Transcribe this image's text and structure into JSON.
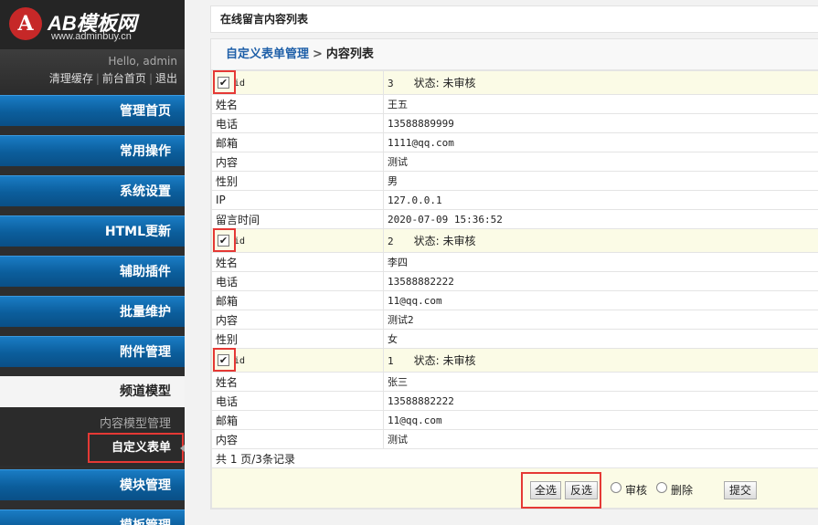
{
  "brand": {
    "logo_letter": "A",
    "title": "AB模板网",
    "subtitle": "www.adminbuy.cn"
  },
  "user": {
    "greeting": "Hello, admin",
    "links": [
      "清理缓存",
      "前台首页",
      "退出"
    ]
  },
  "sidebar": {
    "items_top": [
      "管理首页",
      "常用操作",
      "系统设置",
      "HTML更新",
      "辅助插件",
      "批量维护",
      "附件管理"
    ],
    "active_section": "频道模型",
    "sub_items": [
      "内容模型管理",
      "自定义表单"
    ],
    "current_sub": "自定义表单",
    "items_bottom": [
      "模块管理",
      "模板管理"
    ]
  },
  "page": {
    "header": "在线留言内容列表",
    "breadcrumb_parent": "自定义表单管理",
    "breadcrumb_sep": ">",
    "breadcrumb_current": "内容列表"
  },
  "records": [
    {
      "id_label": "id",
      "id": "3",
      "status": "状态: 未审核",
      "checked": true,
      "fields": [
        {
          "k": "姓名",
          "v": "王五"
        },
        {
          "k": "电话",
          "v": "13588889999"
        },
        {
          "k": "邮箱",
          "v": "1111@qq.com"
        },
        {
          "k": "内容",
          "v": "测试"
        },
        {
          "k": "性别",
          "v": "男"
        },
        {
          "k": "IP",
          "v": "127.0.0.1"
        },
        {
          "k": "留言时间",
          "v": "2020-07-09 15:36:52"
        }
      ]
    },
    {
      "id_label": "id",
      "id": "2",
      "status": "状态: 未审核",
      "checked": true,
      "fields": [
        {
          "k": "姓名",
          "v": "李四"
        },
        {
          "k": "电话",
          "v": "13588882222"
        },
        {
          "k": "邮箱",
          "v": "11@qq.com"
        },
        {
          "k": "内容",
          "v": "测试2"
        },
        {
          "k": "性别",
          "v": "女"
        }
      ]
    },
    {
      "id_label": "id",
      "id": "1",
      "status": "状态: 未审核",
      "checked": true,
      "fields": [
        {
          "k": "姓名",
          "v": "张三"
        },
        {
          "k": "电话",
          "v": "13588882222"
        },
        {
          "k": "邮箱",
          "v": "11@qq.com"
        },
        {
          "k": "内容",
          "v": "测试"
        }
      ]
    }
  ],
  "summary": "共 1 页/3条记录",
  "actions": {
    "select_all": "全选",
    "invert": "反选",
    "radio_approve": "审核",
    "radio_delete": "删除",
    "submit": "提交"
  },
  "colors": {
    "nav_blue": "#0b5d9b",
    "highlight_red": "#e53935",
    "row_head_bg": "#fbfbe6"
  }
}
